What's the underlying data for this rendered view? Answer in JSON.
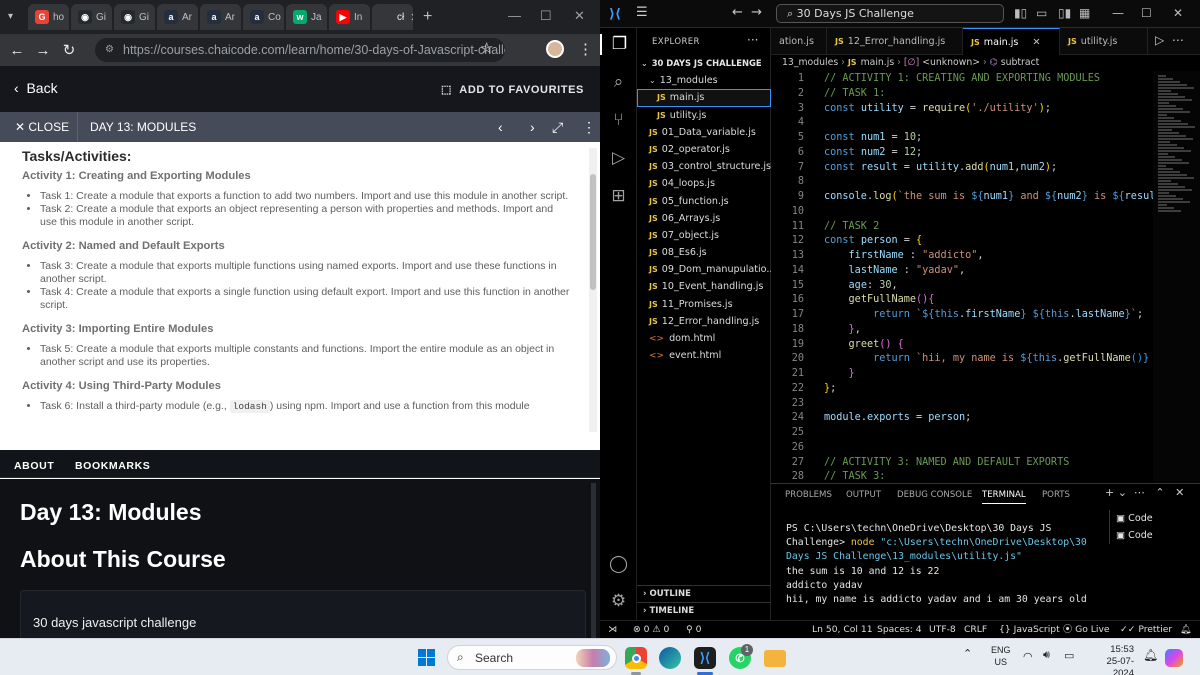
{
  "browser": {
    "tabs": [
      {
        "label": "ho",
        "icon": "google-icon",
        "color": "#ea4335",
        "glyph": "G"
      },
      {
        "label": "Gi",
        "icon": "github-icon",
        "color": "#24292e",
        "glyph": "◉"
      },
      {
        "label": "Gi",
        "icon": "github-icon",
        "color": "#24292e",
        "glyph": "◉"
      },
      {
        "label": "Ar",
        "icon": "amazon-icon",
        "color": "#232f3e",
        "glyph": "a"
      },
      {
        "label": "Ar",
        "icon": "amazon-icon",
        "color": "#232f3e",
        "glyph": "a"
      },
      {
        "label": "Co",
        "icon": "amazon-icon",
        "color": "#232f3e",
        "glyph": "a"
      },
      {
        "label": "Ja",
        "icon": "w3schools-icon",
        "color": "#04aa6d",
        "glyph": "w"
      },
      {
        "label": "In",
        "icon": "youtube-icon",
        "color": "#ff0000",
        "glyph": "▶"
      },
      {
        "label": "cł",
        "icon": "chaicode-icon",
        "color": "#35363a",
        "glyph": ""
      }
    ],
    "url": "https://courses.chaicode.com/learn/home/30-days-of-Javascript-challe..."
  },
  "course": {
    "back_label": "Back",
    "favourites_label": "ADD TO FAVOURITES",
    "close_label": "CLOSE",
    "lesson_title": "DAY 13: MODULES",
    "tasks_heading": "Tasks/Activities:",
    "activities": [
      {
        "title": "Activity 1: Creating and Exporting Modules",
        "tasks": [
          "Task 1: Create a module that exports a function to add two numbers. Import and use this module in another script.",
          "Task 2: Create a module that exports an object representing a person with properties and methods. Import and use this module in another script."
        ]
      },
      {
        "title": "Activity 2: Named and Default Exports",
        "tasks": [
          "Task 3: Create a module that exports multiple functions using named exports. Import and use these functions in another script.",
          "Task 4: Create a module that exports a single function using default export. Import and use this function in another script."
        ]
      },
      {
        "title": "Activity 3: Importing Entire Modules",
        "tasks": [
          "Task 5: Create a module that exports multiple constants and functions. Import the entire module as an object in another script and use its properties."
        ]
      },
      {
        "title": "Activity 4: Using Third-Party Modules",
        "task6_before": "Task 6: Install a third-party module (e.g., ",
        "task6_code": "lodash",
        "task6_after": ") using npm. Import and use a function from this module"
      }
    ],
    "tab_about": "ABOUT",
    "tab_bookmarks": "BOOKMARKS",
    "day_title": "Day 13: Modules",
    "about_title": "About This Course",
    "course_name": "30 days javascript challenge"
  },
  "vscode": {
    "command_center": "30 Days JS Challenge",
    "explorer_label": "EXPLORER",
    "root_folder": "30 DAYS JS CHALLENGE",
    "tree": [
      {
        "name": "13_modules",
        "type": "folder",
        "indent": 1
      },
      {
        "name": "main.js",
        "type": "js",
        "indent": 2,
        "selected": true
      },
      {
        "name": "utility.js",
        "type": "js",
        "indent": 2
      },
      {
        "name": "01_Data_variable.js",
        "type": "js",
        "indent": 1
      },
      {
        "name": "02_operator.js",
        "type": "js",
        "indent": 1
      },
      {
        "name": "03_control_structure.js",
        "type": "js",
        "indent": 1
      },
      {
        "name": "04_loops.js",
        "type": "js",
        "indent": 1
      },
      {
        "name": "05_function.js",
        "type": "js",
        "indent": 1
      },
      {
        "name": "06_Arrays.js",
        "type": "js",
        "indent": 1
      },
      {
        "name": "07_object.js",
        "type": "js",
        "indent": 1
      },
      {
        "name": "08_Es6.js",
        "type": "js",
        "indent": 1
      },
      {
        "name": "09_Dom_manupulatio...",
        "type": "js",
        "indent": 1
      },
      {
        "name": "10_Event_handling.js",
        "type": "js",
        "indent": 1
      },
      {
        "name": "11_Promises.js",
        "type": "js",
        "indent": 1
      },
      {
        "name": "12_Error_handling.js",
        "type": "js",
        "indent": 1
      },
      {
        "name": "dom.html",
        "type": "html",
        "indent": 1
      },
      {
        "name": "event.html",
        "type": "html",
        "indent": 1
      }
    ],
    "outline_label": "OUTLINE",
    "timeline_label": "TIMELINE",
    "editor_tabs": [
      "ation.js",
      "12_Error_handling.js",
      "main.js",
      "utility.js"
    ],
    "breadcrumb": {
      "folder": "13_modules",
      "file": "main.js",
      "scope": "<unknown>",
      "symbol": "subtract"
    },
    "code_lines": [
      {
        "n": "1",
        "segs": [
          [
            "cm",
            "// ACTIVITY 1: CREATING AND EXPORTING MODULES"
          ]
        ]
      },
      {
        "n": "2",
        "segs": [
          [
            "cm",
            "// TASK 1:"
          ]
        ]
      },
      {
        "n": "3",
        "segs": [
          [
            "kw",
            "const "
          ],
          [
            "va",
            "utility"
          ],
          [
            "pl",
            " = "
          ],
          [
            "fn",
            "require"
          ],
          [
            "br1",
            "("
          ],
          [
            "st",
            "'./utility'"
          ],
          [
            "br1",
            ")"
          ],
          [
            "pl",
            ";"
          ]
        ]
      },
      {
        "n": "4",
        "segs": []
      },
      {
        "n": "5",
        "segs": [
          [
            "kw",
            "const "
          ],
          [
            "va",
            "num1"
          ],
          [
            "pl",
            " = "
          ],
          [
            "nu",
            "10"
          ],
          [
            "pl",
            ";"
          ]
        ]
      },
      {
        "n": "6",
        "segs": [
          [
            "kw",
            "const "
          ],
          [
            "va",
            "num2"
          ],
          [
            "pl",
            " = "
          ],
          [
            "nu",
            "12"
          ],
          [
            "pl",
            ";"
          ]
        ]
      },
      {
        "n": "7",
        "segs": [
          [
            "kw",
            "const "
          ],
          [
            "va",
            "result"
          ],
          [
            "pl",
            " = "
          ],
          [
            "va",
            "utility"
          ],
          [
            "pl",
            "."
          ],
          [
            "fn",
            "add"
          ],
          [
            "br1",
            "("
          ],
          [
            "va",
            "num1"
          ],
          [
            "pl",
            ","
          ],
          [
            "va",
            "num2"
          ],
          [
            "br1",
            ")"
          ],
          [
            "pl",
            ";"
          ]
        ]
      },
      {
        "n": "8",
        "segs": []
      },
      {
        "n": "9",
        "segs": [
          [
            "va",
            "console"
          ],
          [
            "pl",
            "."
          ],
          [
            "fn",
            "log"
          ],
          [
            "br1",
            "("
          ],
          [
            "st",
            "`the sum is "
          ],
          [
            "kw",
            "${"
          ],
          [
            "va",
            "num1"
          ],
          [
            "kw",
            "}"
          ],
          [
            "st",
            " and "
          ],
          [
            "kw",
            "${"
          ],
          [
            "va",
            "num2"
          ],
          [
            "kw",
            "}"
          ],
          [
            "st",
            " is "
          ],
          [
            "kw",
            "${"
          ],
          [
            "va",
            "resul"
          ]
        ]
      },
      {
        "n": "10",
        "segs": []
      },
      {
        "n": "11",
        "segs": [
          [
            "cm",
            "// TASK 2"
          ]
        ]
      },
      {
        "n": "12",
        "segs": [
          [
            "kw",
            "const "
          ],
          [
            "va",
            "person"
          ],
          [
            "pl",
            " = "
          ],
          [
            "br1",
            "{"
          ]
        ]
      },
      {
        "n": "13",
        "segs": [
          [
            "pl",
            "    "
          ],
          [
            "va",
            "firstName"
          ],
          [
            "pl",
            " : "
          ],
          [
            "st",
            "\"addicto\""
          ],
          [
            "pl",
            ","
          ]
        ]
      },
      {
        "n": "14",
        "segs": [
          [
            "pl",
            "    "
          ],
          [
            "va",
            "lastName"
          ],
          [
            "pl",
            " : "
          ],
          [
            "st",
            "\"yadav\""
          ],
          [
            "pl",
            ","
          ]
        ]
      },
      {
        "n": "15",
        "segs": [
          [
            "pl",
            "    "
          ],
          [
            "va",
            "age"
          ],
          [
            "pl",
            ": "
          ],
          [
            "nu",
            "30"
          ],
          [
            "pl",
            ","
          ]
        ]
      },
      {
        "n": "16",
        "segs": [
          [
            "pl",
            "    "
          ],
          [
            "fn",
            "getFullName"
          ],
          [
            "br2",
            "()"
          ],
          [
            "br2",
            "{"
          ]
        ]
      },
      {
        "n": "17",
        "segs": [
          [
            "pl",
            "        "
          ],
          [
            "kw",
            "return "
          ],
          [
            "st",
            "`"
          ],
          [
            "kw",
            "${"
          ],
          [
            "th",
            "this"
          ],
          [
            "pl",
            "."
          ],
          [
            "va",
            "firstName"
          ],
          [
            "kw",
            "}"
          ],
          [
            "st",
            " "
          ],
          [
            "kw",
            "${"
          ],
          [
            "th",
            "this"
          ],
          [
            "pl",
            "."
          ],
          [
            "va",
            "lastName"
          ],
          [
            "kw",
            "}"
          ],
          [
            "st",
            "`"
          ],
          [
            "pl",
            ";"
          ]
        ]
      },
      {
        "n": "18",
        "segs": [
          [
            "pl",
            "    "
          ],
          [
            "br2",
            "}"
          ],
          [
            "pl",
            ","
          ]
        ]
      },
      {
        "n": "19",
        "segs": [
          [
            "pl",
            "    "
          ],
          [
            "fn",
            "greet"
          ],
          [
            "br2",
            "()"
          ],
          [
            "pl",
            " "
          ],
          [
            "br2",
            "{"
          ]
        ]
      },
      {
        "n": "20",
        "segs": [
          [
            "pl",
            "        "
          ],
          [
            "kw",
            "return "
          ],
          [
            "st",
            "`hii, my name is "
          ],
          [
            "kw",
            "${"
          ],
          [
            "th",
            "this"
          ],
          [
            "pl",
            "."
          ],
          [
            "fn",
            "getFullName"
          ],
          [
            "br3",
            "()"
          ],
          [
            "kw",
            "}"
          ]
        ]
      },
      {
        "n": "21",
        "segs": [
          [
            "pl",
            "    "
          ],
          [
            "br2",
            "}"
          ]
        ]
      },
      {
        "n": "22",
        "segs": [
          [
            "br1",
            "}"
          ],
          [
            "pl",
            ";"
          ]
        ]
      },
      {
        "n": "23",
        "segs": []
      },
      {
        "n": "24",
        "segs": [
          [
            "va",
            "module"
          ],
          [
            "pl",
            "."
          ],
          [
            "va",
            "exports"
          ],
          [
            "pl",
            " = "
          ],
          [
            "va",
            "person"
          ],
          [
            "pl",
            ";"
          ]
        ]
      },
      {
        "n": "25",
        "segs": []
      },
      {
        "n": "26",
        "segs": []
      },
      {
        "n": "27",
        "segs": [
          [
            "cm",
            "// ACTIVITY 3: NAMED AND DEFAULT EXPORTS"
          ]
        ]
      },
      {
        "n": "28",
        "segs": [
          [
            "cm",
            "// TASK 3:"
          ]
        ]
      }
    ],
    "panel_tabs": [
      "PROBLEMS",
      "OUTPUT",
      "DEBUG CONSOLE",
      "TERMINAL",
      "PORTS"
    ],
    "terminal": {
      "prompt": "PS C:\\Users\\techn\\OneDrive\\Desktop\\30 Days JS Challenge> ",
      "cmd": "node",
      "arg": " \"c:\\Users\\techn\\OneDrive\\Desktop\\30 Days JS Challenge\\13_modules\\utility.js\"",
      "output": [
        "the sum is 10 and 12 is 22",
        "addicto yadav",
        "hii, my name is addicto yadav and i am 30 years old"
      ]
    },
    "terminals": [
      "Code",
      "Code"
    ],
    "status": {
      "problems": "⊗ 0 ⚠ 0",
      "ports": "0",
      "position": "Ln 50, Col 11",
      "spaces": "Spaces: 4",
      "encoding": "UTF-8",
      "eol": "CRLF",
      "language": "JavaScript",
      "golive": "Go Live",
      "prettier": "Prettier"
    }
  },
  "taskbar": {
    "search_placeholder": "Search",
    "lang_top": "ENG",
    "lang_bottom": "US",
    "time": "15:53",
    "date": "25-07-2024",
    "whatsapp_badge": "1"
  }
}
